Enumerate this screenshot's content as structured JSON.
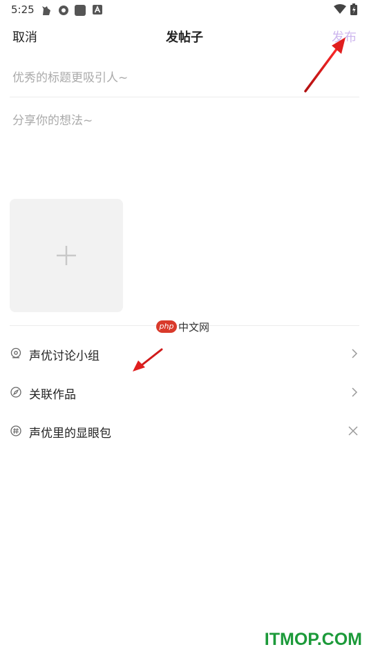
{
  "status_bar": {
    "time": "5:25",
    "icons": [
      "cat-notification-icon",
      "hexagon-app-icon",
      "square-app-icon",
      "a-app-icon",
      "wifi-icon",
      "battery-icon"
    ]
  },
  "header": {
    "cancel_label": "取消",
    "title": "发帖子",
    "publish_label": "发布",
    "publish_color": "#cdb6ee"
  },
  "compose": {
    "title_placeholder": "优秀的标题更吸引人~",
    "content_placeholder": "分享你的想法~",
    "add_image_icon": "plus-icon"
  },
  "watermark": {
    "badge": "php",
    "text": "中文网"
  },
  "options": [
    {
      "label": "声优讨论小组",
      "icon": "group-icon",
      "action": "chevron-right-icon"
    },
    {
      "label": "关联作品",
      "icon": "compass-icon",
      "action": "chevron-right-icon"
    },
    {
      "label": "声优里的显眼包",
      "icon": "hashtag-icon",
      "action": "close-icon"
    }
  ],
  "annotation_color": "#e01e1e",
  "footer": {
    "site_logo": "ITMOP.COM",
    "logo_color": "#1c9a3a"
  }
}
